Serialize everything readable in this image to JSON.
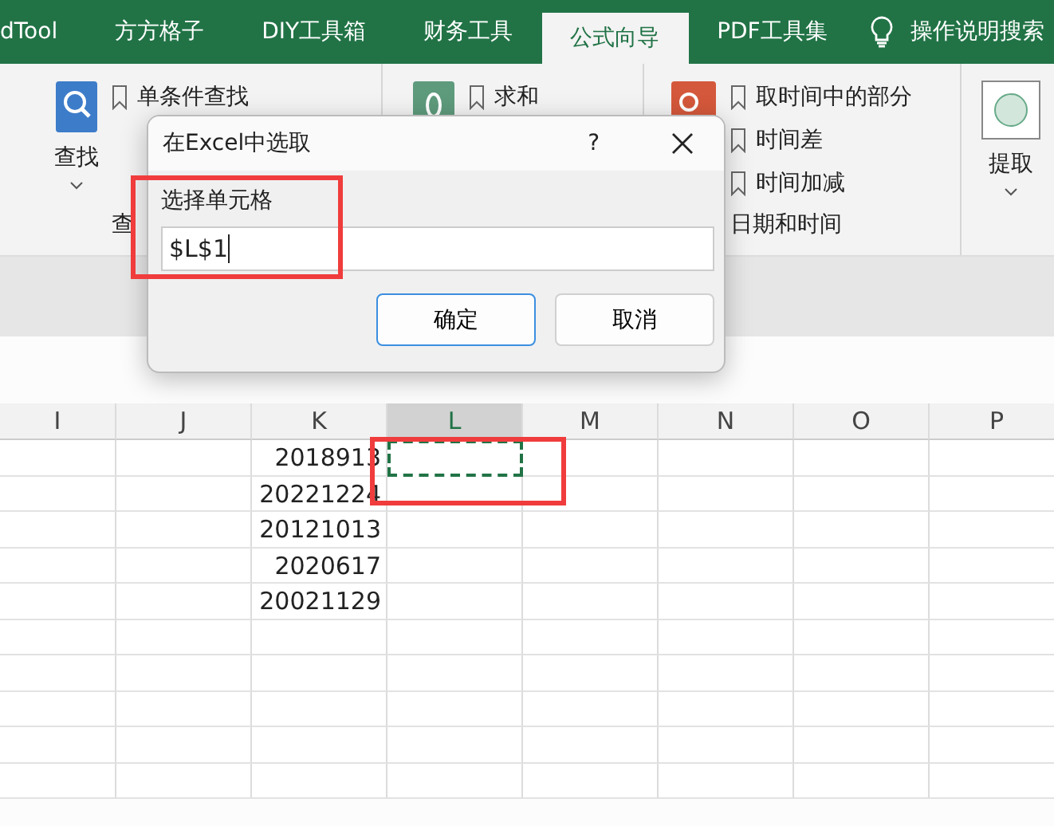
{
  "menu_tabs": [
    {
      "label": "dTool",
      "selected": false
    },
    {
      "label": "方方格子",
      "selected": false
    },
    {
      "label": "DIY工具箱",
      "selected": false
    },
    {
      "label": "财务工具",
      "selected": false
    },
    {
      "label": "公式向导",
      "selected": true
    },
    {
      "label": "PDF工具集",
      "selected": false
    }
  ],
  "help_search": "操作说明搜索",
  "ribbon": {
    "find_button": "查找",
    "find_items": [
      "单条件查找"
    ],
    "find_group_label": "查",
    "sum_items": [
      "求和"
    ],
    "date_items": [
      "取时间中的部分",
      "时间差",
      "时间加减"
    ],
    "date_group_label": "日期和时间",
    "extract_button": "提取"
  },
  "dialog": {
    "title": "在Excel中选取",
    "help": "?",
    "field_label": "选择单元格",
    "field_value": "$L$1",
    "buttons": [
      {
        "label": "确定",
        "kind": "default"
      },
      {
        "label": "取消",
        "kind": "normal"
      }
    ]
  },
  "sheet": {
    "columns": [
      "I",
      "J",
      "K",
      "L",
      "M",
      "N",
      "O",
      "P"
    ],
    "rows": [
      {
        "cells": [
          {
            "marked": false
          },
          {
            "marked": false
          },
          {
            "text": "2018913",
            "marked": false
          },
          {
            "marked": true
          },
          {
            "marked": false
          },
          {
            "marked": false
          },
          {
            "marked": false
          },
          {
            "marked": false
          }
        ]
      },
      {
        "cells": [
          {
            "marked": false
          },
          {
            "marked": false
          },
          {
            "text": "20221224",
            "marked": false
          },
          {
            "marked": false
          },
          {
            "marked": false
          },
          {
            "marked": false
          },
          {
            "marked": false
          },
          {
            "marked": false
          }
        ]
      },
      {
        "cells": [
          {
            "marked": false
          },
          {
            "marked": false
          },
          {
            "text": "20121013",
            "marked": false
          },
          {
            "marked": false
          },
          {
            "marked": false
          },
          {
            "marked": false
          },
          {
            "marked": false
          },
          {
            "marked": false
          }
        ]
      },
      {
        "cells": [
          {
            "marked": false
          },
          {
            "marked": false
          },
          {
            "text": "2020617",
            "marked": false
          },
          {
            "marked": false
          },
          {
            "marked": false
          },
          {
            "marked": false
          },
          {
            "marked": false
          },
          {
            "marked": false
          }
        ]
      },
      {
        "cells": [
          {
            "marked": false
          },
          {
            "marked": false
          },
          {
            "text": "20021129",
            "marked": false
          },
          {
            "marked": false
          },
          {
            "marked": false
          },
          {
            "marked": false
          },
          {
            "marked": false
          },
          {
            "marked": false
          }
        ]
      }
    ]
  }
}
